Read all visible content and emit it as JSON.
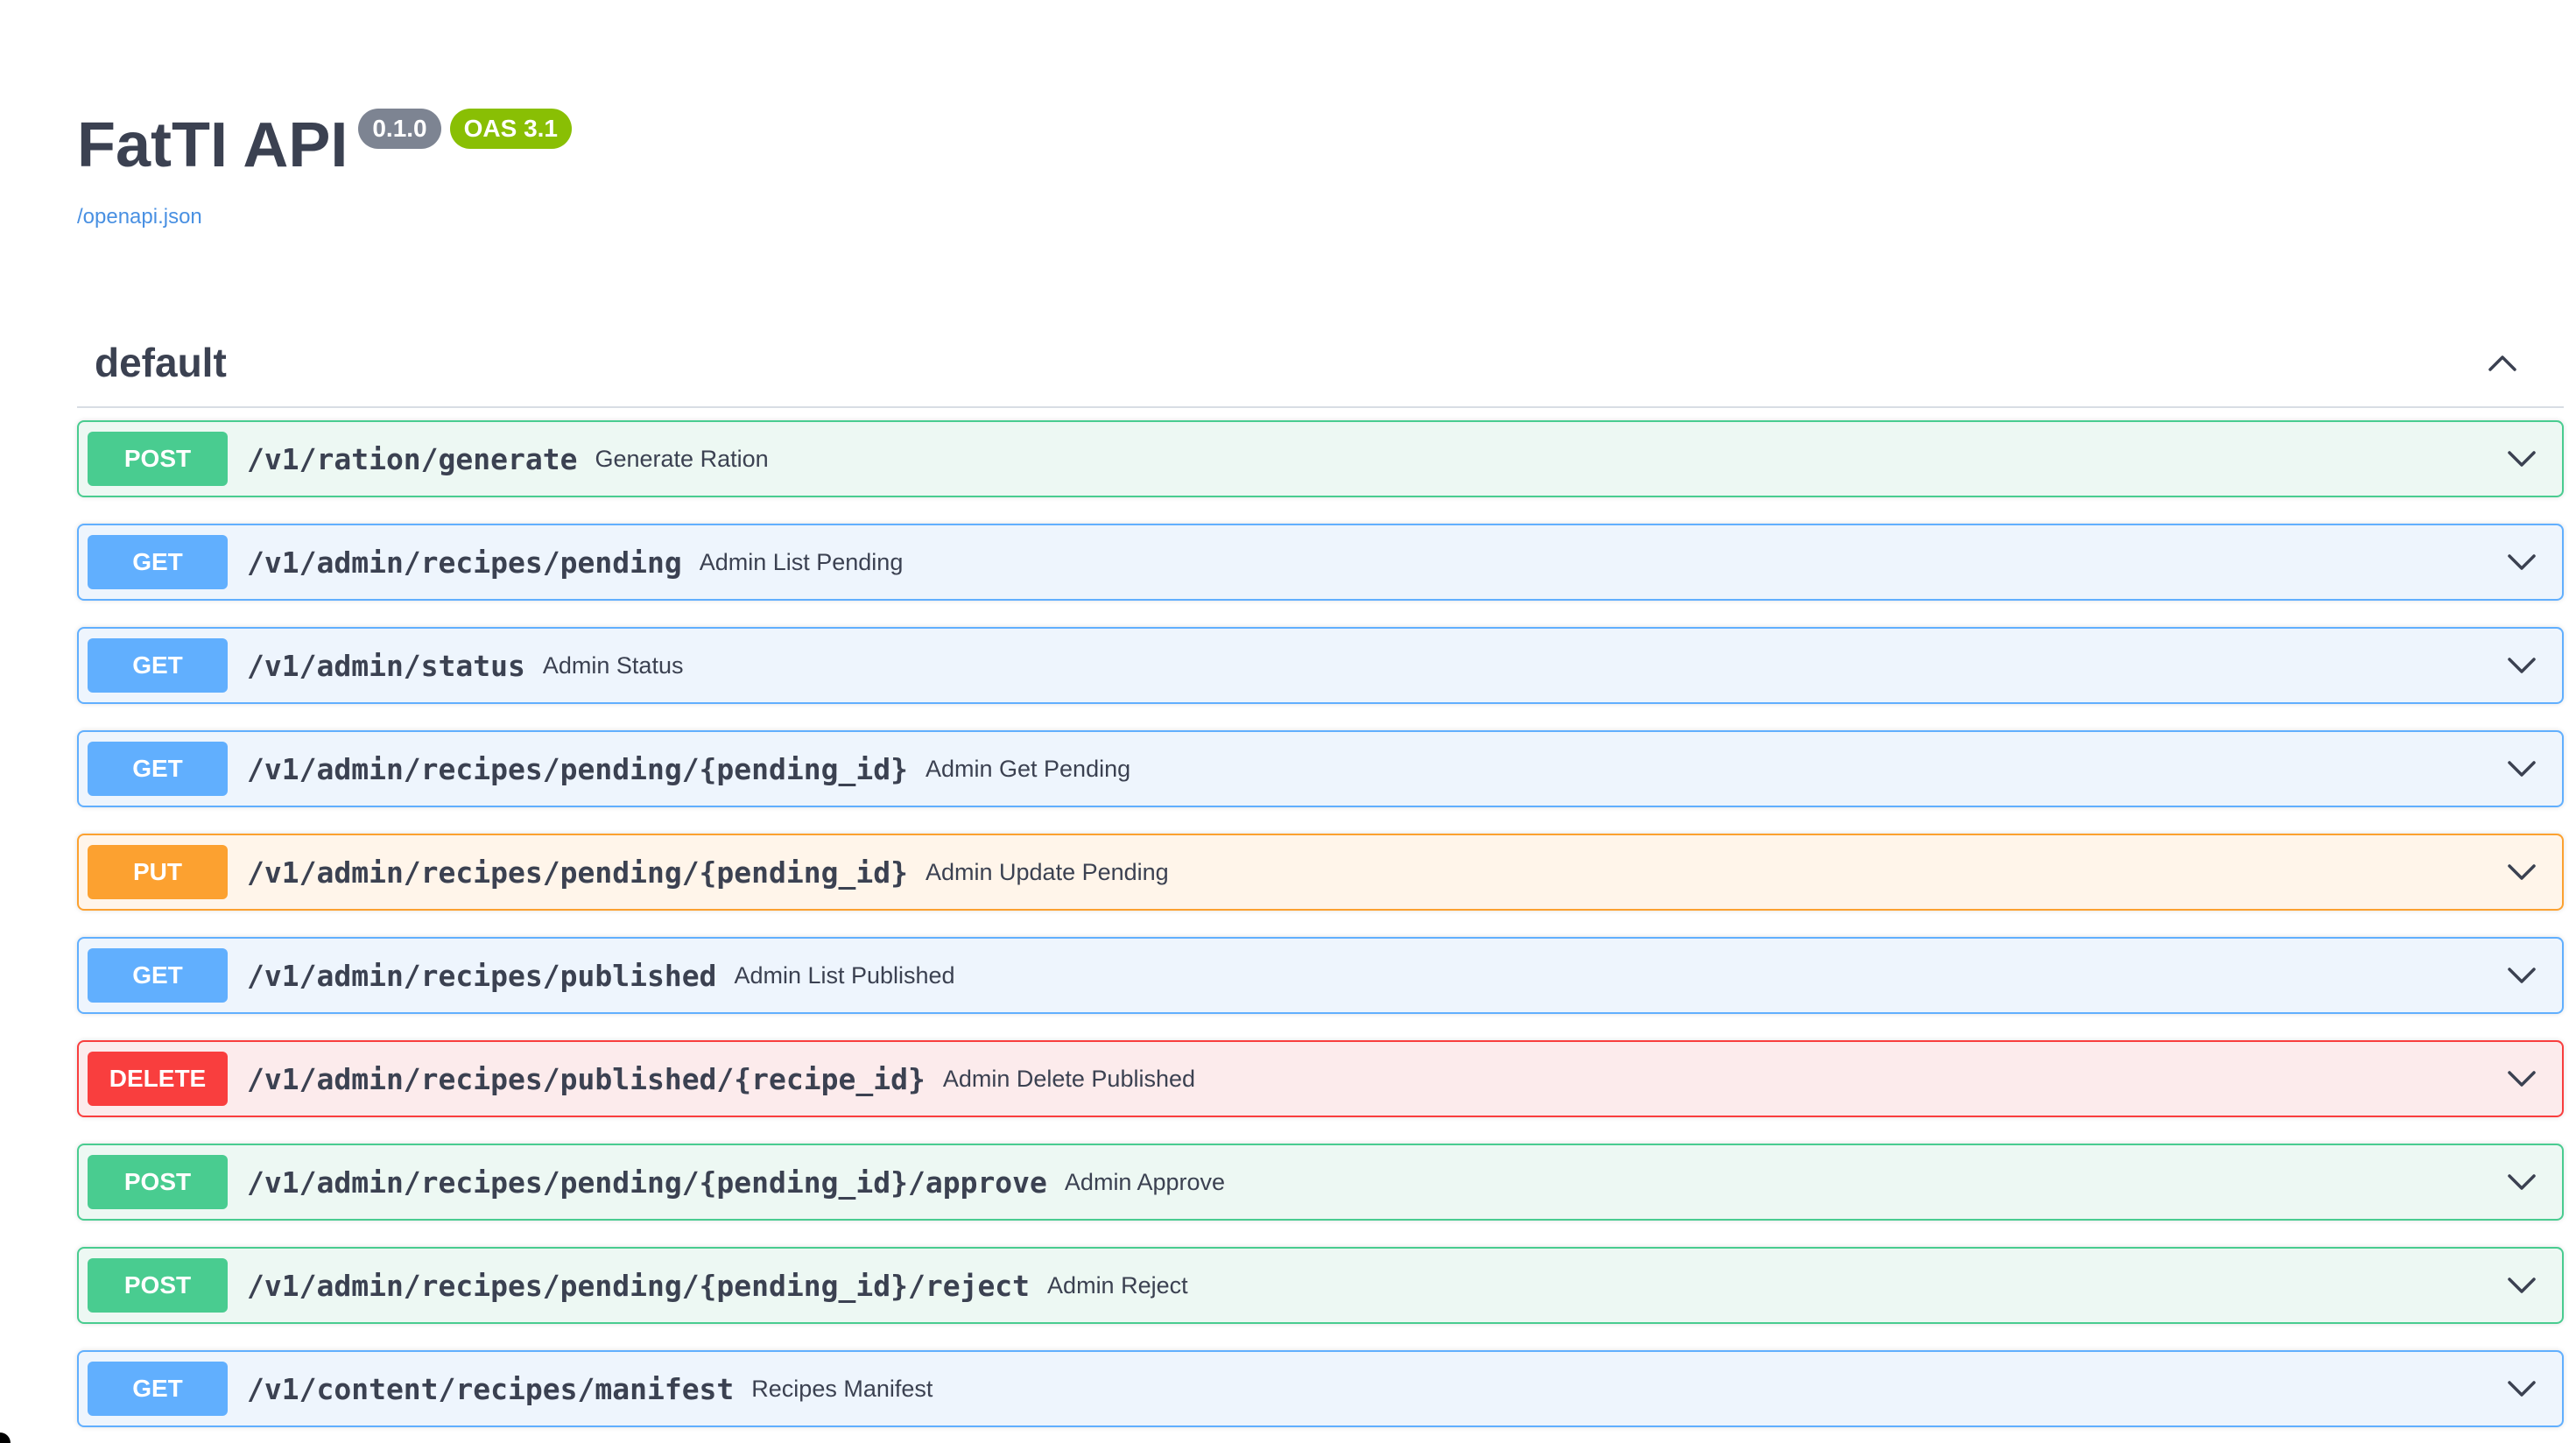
{
  "info": {
    "title": "FatTI API",
    "version": "0.1.0",
    "oas": "OAS 3.1",
    "spec_link": "/openapi.json"
  },
  "section": {
    "title": "default",
    "expanded": true
  },
  "operations": [
    {
      "method": "POST",
      "path": "/v1/ration/generate",
      "summary": "Generate Ration"
    },
    {
      "method": "GET",
      "path": "/v1/admin/recipes/pending",
      "summary": "Admin List Pending"
    },
    {
      "method": "GET",
      "path": "/v1/admin/status",
      "summary": "Admin Status"
    },
    {
      "method": "GET",
      "path": "/v1/admin/recipes/pending/{pending_id}",
      "summary": "Admin Get Pending"
    },
    {
      "method": "PUT",
      "path": "/v1/admin/recipes/pending/{pending_id}",
      "summary": "Admin Update Pending"
    },
    {
      "method": "GET",
      "path": "/v1/admin/recipes/published",
      "summary": "Admin List Published"
    },
    {
      "method": "DELETE",
      "path": "/v1/admin/recipes/published/{recipe_id}",
      "summary": "Admin Delete Published"
    },
    {
      "method": "POST",
      "path": "/v1/admin/recipes/pending/{pending_id}/approve",
      "summary": "Admin Approve"
    },
    {
      "method": "POST",
      "path": "/v1/admin/recipes/pending/{pending_id}/reject",
      "summary": "Admin Reject"
    },
    {
      "method": "GET",
      "path": "/v1/content/recipes/manifest",
      "summary": "Recipes Manifest"
    }
  ],
  "colors": {
    "post": "#49cc90",
    "get": "#61affe",
    "put": "#fca130",
    "delete": "#f93e3e",
    "version_badge": "#7d8492",
    "oas_badge": "#89bf04",
    "link": "#4990e2"
  },
  "icons": {
    "section_toggle": "chevron-up-icon",
    "operation_toggle": "chevron-down-icon"
  }
}
